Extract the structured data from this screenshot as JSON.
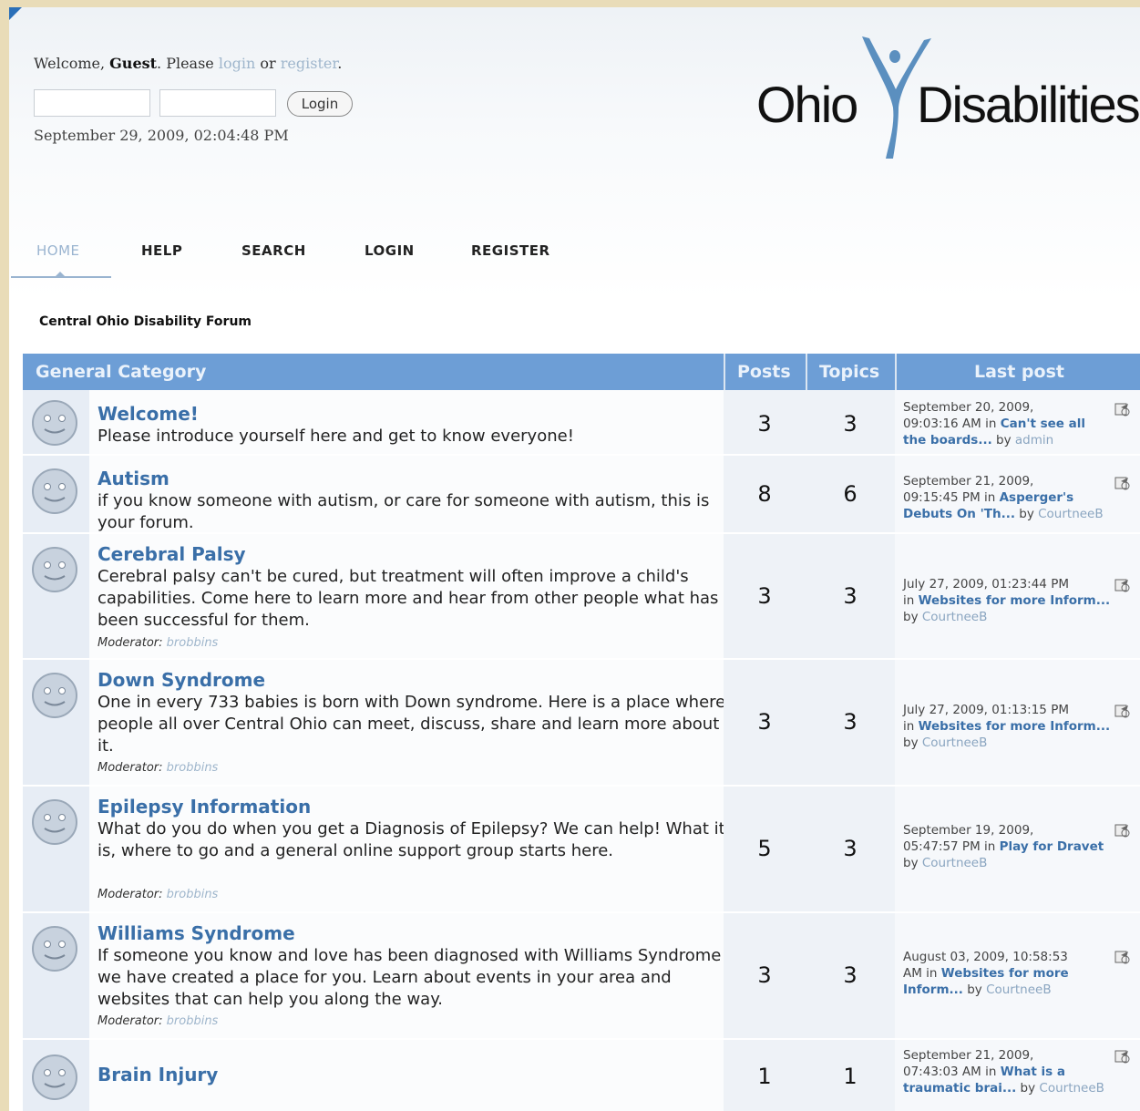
{
  "user_area": {
    "welcome_prefix": "Welcome,",
    "guest": "Guest",
    "please": ". Please",
    "login_link": "login",
    "or": "or",
    "register_link": "register",
    "period": ".",
    "username_value": "",
    "password_value": "",
    "login_button": "Login",
    "datetime": "September 29, 2009, 02:04:48 PM"
  },
  "logo": {
    "left_word": "Ohio",
    "right_word": "Disabilities",
    "brand_color": "#5b8fbf"
  },
  "nav": [
    "HOME",
    "HELP",
    "SEARCH",
    "LOGIN",
    "REGISTER"
  ],
  "breadcrumb": "Central Ohio Disability Forum",
  "table": {
    "category": "General Category",
    "col_posts": "Posts",
    "col_topics": "Topics",
    "col_last_post": "Last post",
    "header_color": "#6d9ed6",
    "boards": [
      {
        "title": "Welcome!",
        "desc": "Please introduce yourself here and get to know everyone!",
        "moderator_label": "",
        "moderator": "",
        "posts": "3",
        "topics": "3",
        "lp_line1": "September 20, 2009,",
        "lp_line2a": "09:03:16 AM in ",
        "lp_topic": "Can't see all the boards...",
        "lp_by": " by ",
        "lp_user": "admin"
      },
      {
        "title": "Autism",
        "desc": "if you know someone with autism, or care for someone with autism, this is your forum.",
        "moderator_label": "",
        "moderator": "",
        "posts": "8",
        "topics": "6",
        "lp_line1": "September 21, 2009,",
        "lp_line2a": "09:15:45 PM in ",
        "lp_topic": "Asperger's Debuts On 'Th...",
        "lp_by": " by ",
        "lp_user": "CourtneeB"
      },
      {
        "title": "Cerebral Palsy",
        "desc": "Cerebral palsy can't be cured, but treatment will often improve a child's capabilities. Come here to learn more and hear from other people what has been successful for them.",
        "moderator_label": "Moderator:",
        "moderator": "brobbins",
        "posts": "3",
        "topics": "3",
        "lp_line1": "July 27, 2009, 01:23:44 PM",
        "lp_line2a": "in ",
        "lp_topic": "Websites for more Inform...",
        "lp_by": " by ",
        "lp_user": "CourtneeB"
      },
      {
        "title": "Down Syndrome",
        "desc": "One in every 733 babies is born with Down syndrome. Here is a place where people all over Central Ohio can meet, discuss, share and learn more about it.",
        "moderator_label": "Moderator:",
        "moderator": "brobbins",
        "posts": "3",
        "topics": "3",
        "lp_line1": "July 27, 2009, 01:13:15 PM",
        "lp_line2a": "in ",
        "lp_topic": "Websites for more Inform...",
        "lp_by": " by ",
        "lp_user": "CourtneeB"
      },
      {
        "title": "Epilepsy Information",
        "desc": "What do you do when you get a Diagnosis of Epilepsy? We can help! What it is, where to go and a general online support group starts here.",
        "moderator_label": "Moderator:",
        "moderator": "brobbins",
        "posts": "5",
        "topics": "3",
        "lp_line1": "September 19, 2009,",
        "lp_line2a": "05:47:57 PM in ",
        "lp_topic": "Play for Dravet",
        "lp_by": " by ",
        "lp_user": "CourtneeB"
      },
      {
        "title": "Williams Syndrome",
        "desc": "If someone you know and love has been diagnosed with Williams Syndrome we have created a place for you. Learn about events in your area and websites that can help you along the way.",
        "moderator_label": "Moderator:",
        "moderator": "brobbins",
        "posts": "3",
        "topics": "3",
        "lp_line1": "August 03, 2009, 10:58:53",
        "lp_line2a": "AM in ",
        "lp_topic": "Websites for more Inform...",
        "lp_by": " by ",
        "lp_user": "CourtneeB"
      },
      {
        "title": "Brain Injury",
        "desc": "",
        "moderator_label": "",
        "moderator": "",
        "posts": "1",
        "topics": "1",
        "lp_line1": "September 21, 2009,",
        "lp_line2a": "07:43:03 AM in ",
        "lp_topic": "What is a traumatic brai...",
        "lp_by": " by ",
        "lp_user": "CourtneeB"
      }
    ]
  }
}
